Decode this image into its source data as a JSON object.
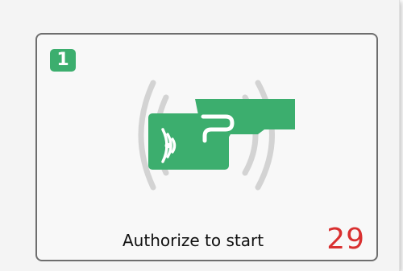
{
  "panel": {
    "slot_number": "1",
    "icon": "rfid-card-tap-icon",
    "status_text": "Authorize to start",
    "countdown": "29",
    "colors": {
      "accent": "#3cae6e",
      "countdown": "#d93030",
      "wave": "#d3d3d3"
    }
  }
}
